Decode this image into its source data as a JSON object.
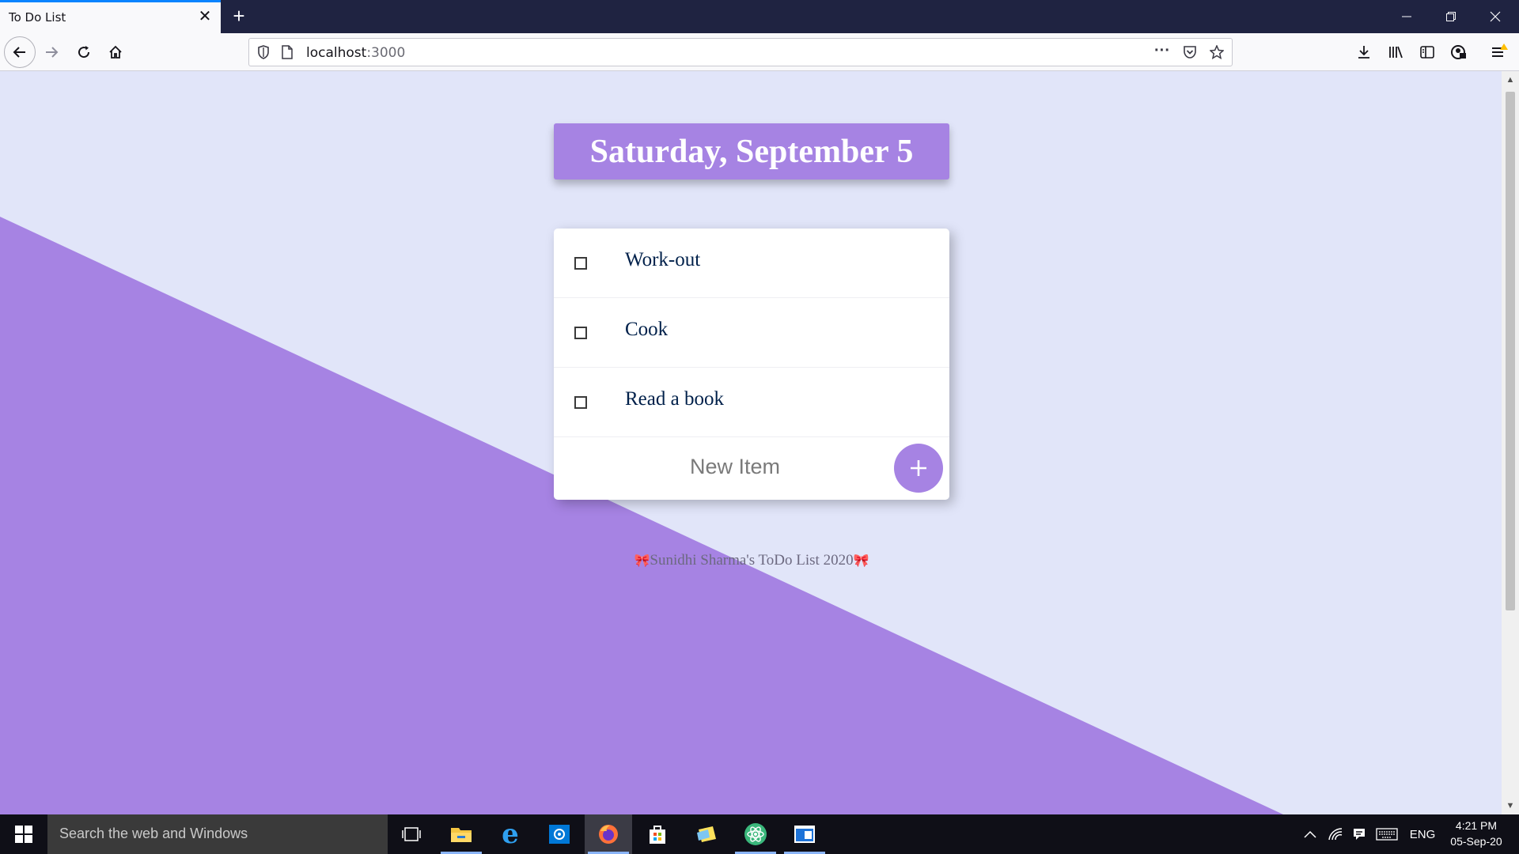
{
  "browser": {
    "tab_title": "To Do List",
    "url_host": "localhost",
    "url_port": ":3000",
    "accent_color": "#0a84ff"
  },
  "page": {
    "heading": "Saturday, September 5",
    "items": [
      {
        "label": "Work-out",
        "checked": false
      },
      {
        "label": "Cook",
        "checked": false
      },
      {
        "label": "Read a book",
        "checked": false
      }
    ],
    "new_item_placeholder": "New Item",
    "add_button_label": "+",
    "footer": "Sunidhi Sharma's ToDo List 2020",
    "theme_color": "#a683e3",
    "background_color": "#e1e5f9"
  },
  "taskbar": {
    "search_placeholder": "Search the web and Windows",
    "language": "ENG",
    "time": "4:21 PM",
    "date": "05-Sep-20"
  }
}
